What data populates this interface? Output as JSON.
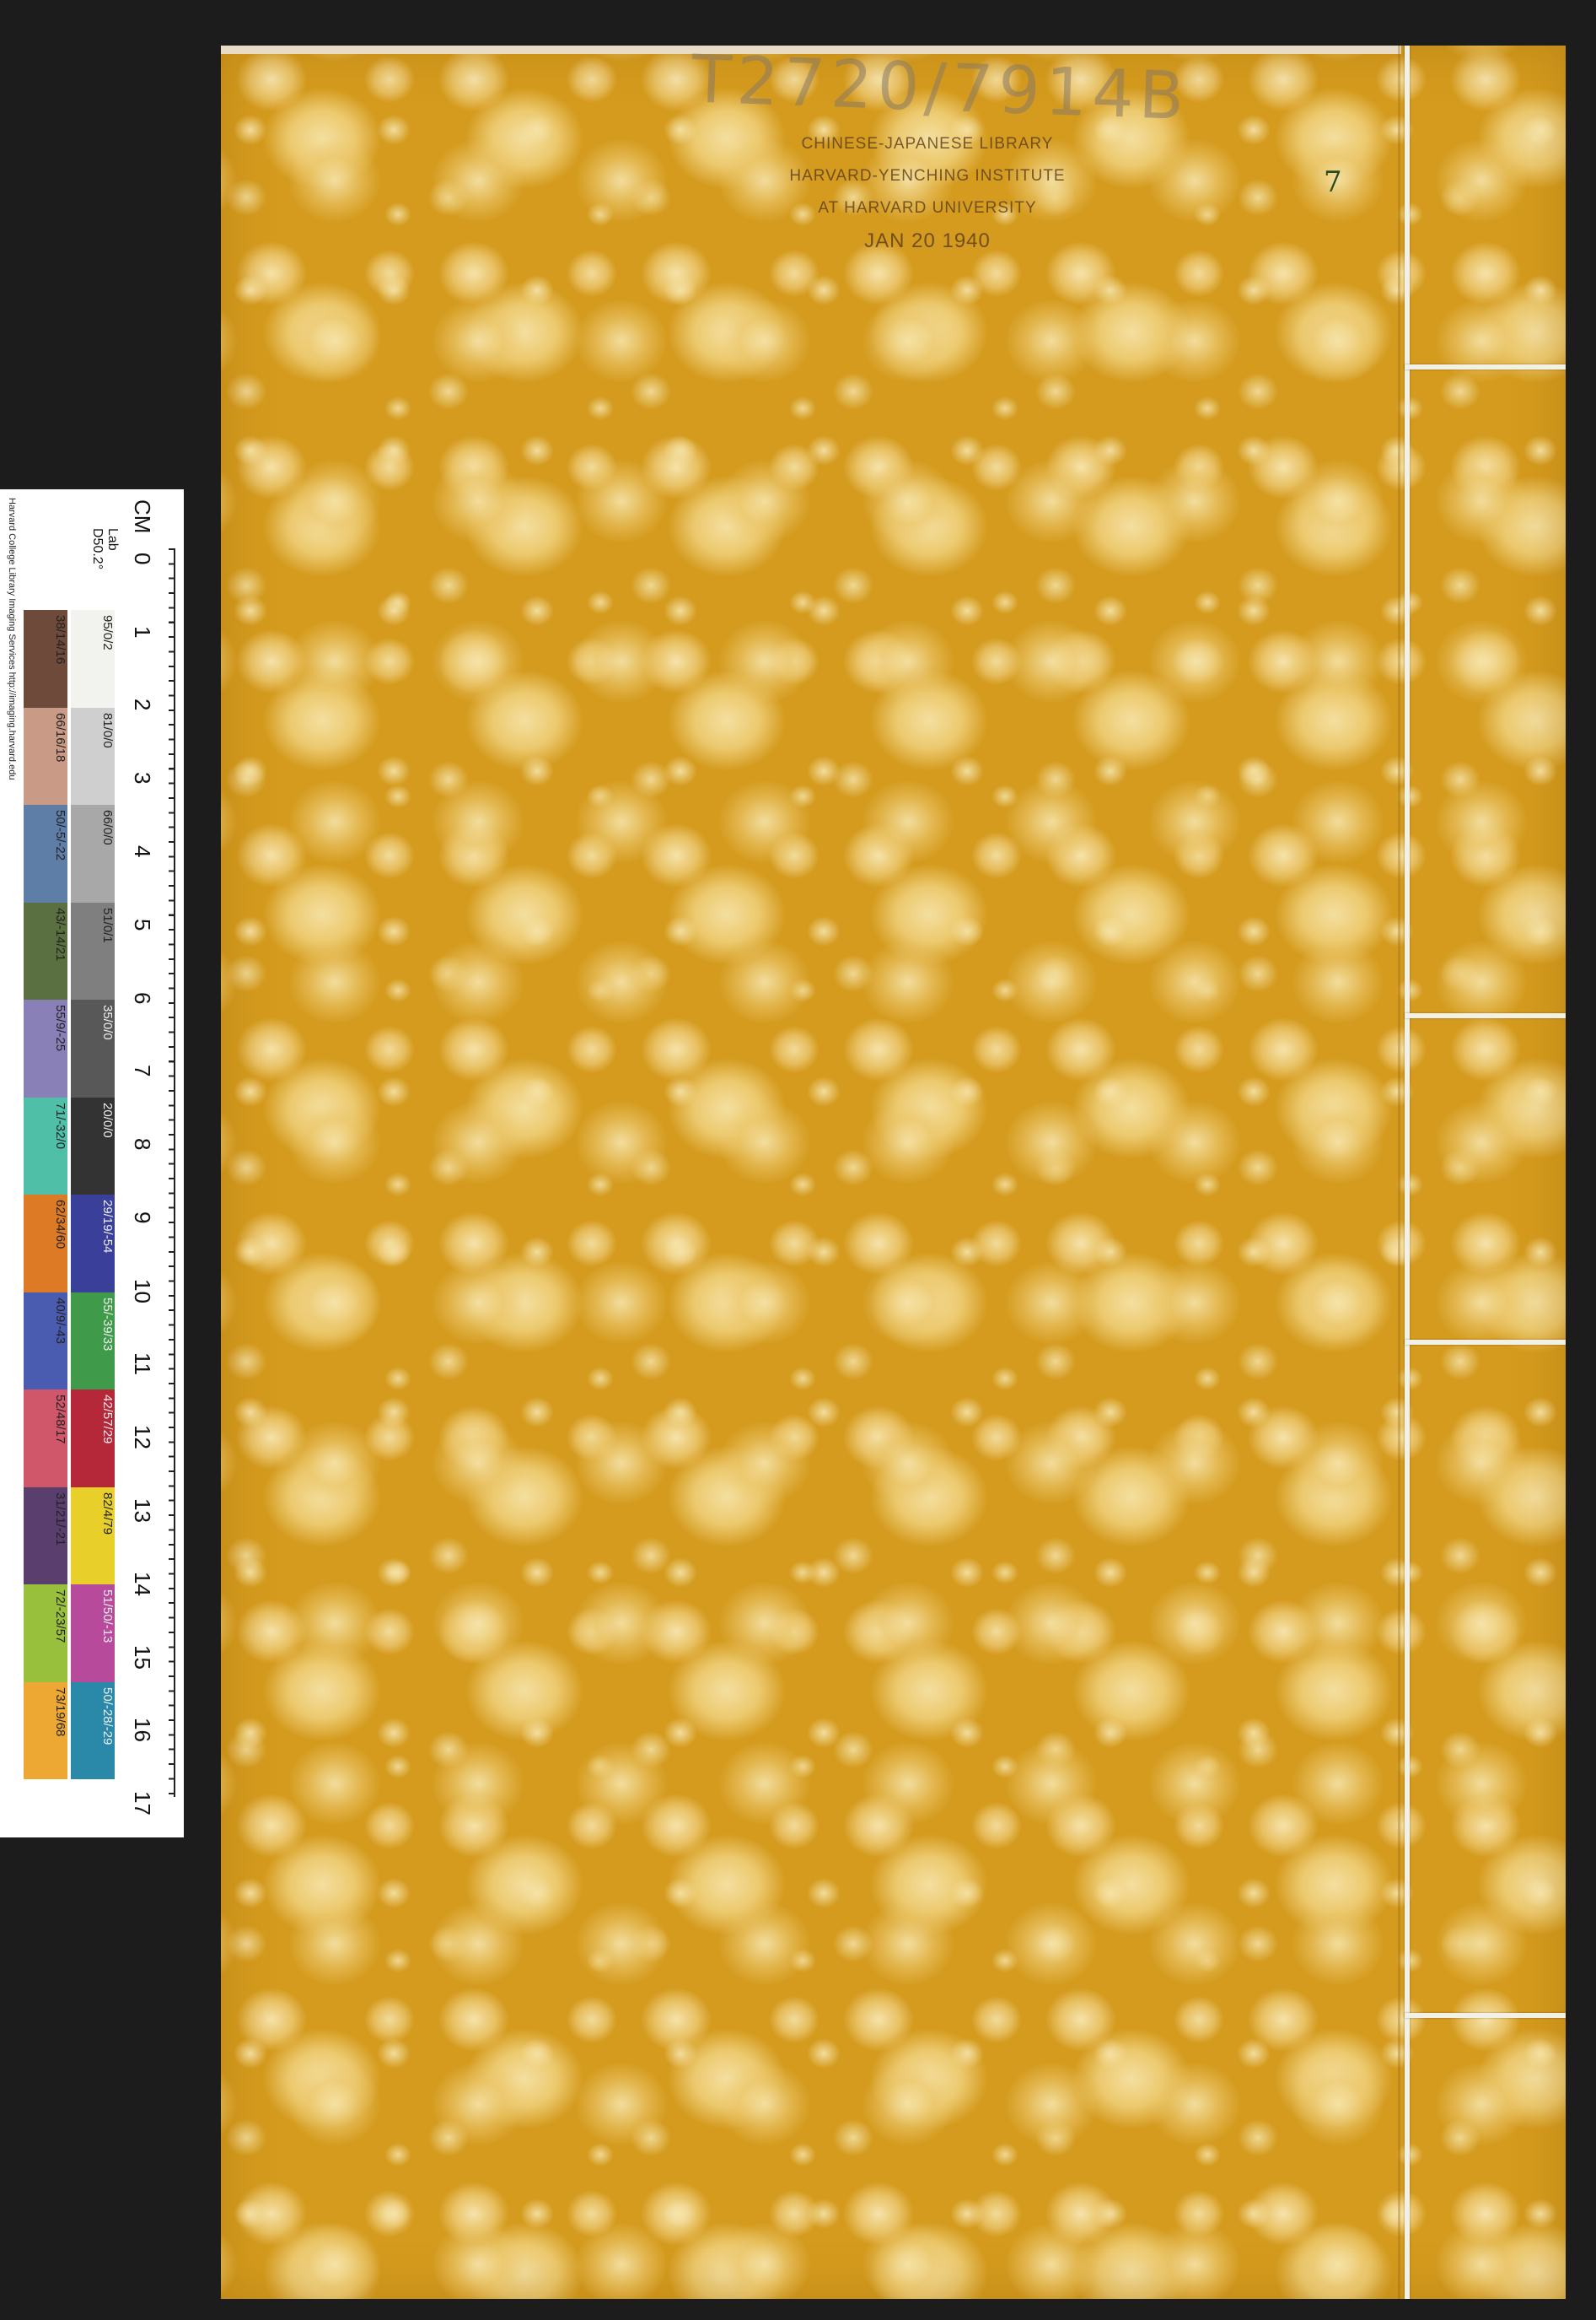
{
  "call_number": "T2720/7914B",
  "library_stamp": {
    "line1": "CHINESE-JAPANESE LIBRARY",
    "line2": "HARVARD-YENCHING INSTITUTE",
    "line3": "AT HARVARD UNIVERSITY",
    "date": "JAN 20 1940"
  },
  "margin_mark": "7",
  "color_ruler": {
    "unit": "CM",
    "illuminant": "Lab D50.2°",
    "credit": "Harvard College Library Imaging Services http://imaging.harvard.edu",
    "numbers": [
      "0",
      "1",
      "2",
      "3",
      "4",
      "5",
      "6",
      "7",
      "8",
      "9",
      "10",
      "11",
      "12",
      "13",
      "14",
      "15",
      "16",
      "17"
    ],
    "gray_patches": [
      {
        "label": "95/0/2",
        "color": "#f2f2ee"
      },
      {
        "label": "81/0/0",
        "color": "#cfcfcf"
      },
      {
        "label": "66/0/0",
        "color": "#a8a8a8"
      },
      {
        "label": "51/0/1",
        "color": "#7f7f7f"
      },
      {
        "label": "35/0/0",
        "color": "#585858"
      },
      {
        "label": "20/0/0",
        "color": "#333333"
      },
      {
        "label": "29/19/-54",
        "color": "#3a3f9a"
      },
      {
        "label": "55/-39/33",
        "color": "#3f9a4a"
      },
      {
        "label": "42/57/29",
        "color": "#b5283a"
      },
      {
        "label": "82/4/79",
        "color": "#e8cf2a"
      },
      {
        "label": "51/50/-13",
        "color": "#b84a9c"
      },
      {
        "label": "50/-28/-29",
        "color": "#2a88a8"
      }
    ],
    "color_patches": [
      {
        "label": "38/14/16",
        "color": "#6e4a3a"
      },
      {
        "label": "66/16/18",
        "color": "#c99a86"
      },
      {
        "label": "50/-5/-22",
        "color": "#5e7ea8"
      },
      {
        "label": "43/-14/21",
        "color": "#5a7040"
      },
      {
        "label": "55/9/-25",
        "color": "#8a80b8"
      },
      {
        "label": "71/-32/0",
        "color": "#4fbfa8"
      },
      {
        "label": "62/34/60",
        "color": "#dc7a26"
      },
      {
        "label": "40/9/-43",
        "color": "#4a5cb0"
      },
      {
        "label": "52/48/17",
        "color": "#d0566a"
      },
      {
        "label": "31/21/-21",
        "color": "#5a3e6e"
      },
      {
        "label": "72/-23/57",
        "color": "#98c03c"
      },
      {
        "label": "73/19/68",
        "color": "#eca832"
      }
    ]
  }
}
